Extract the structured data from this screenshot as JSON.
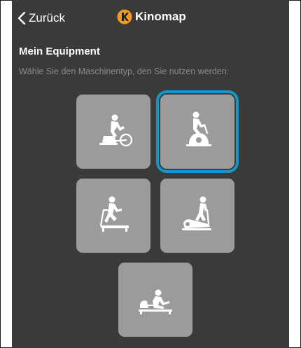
{
  "nav": {
    "back_label": "Zurück",
    "brand_name": "Kinomap"
  },
  "equipment": {
    "title": "Mein Equipment",
    "subtitle": "Wähle Sie den Maschinentyp, den Sie nutzen werden:",
    "machines": [
      {
        "icon": "bike-icon",
        "selected": false
      },
      {
        "icon": "exercise-bike-icon",
        "selected": true
      },
      {
        "icon": "treadmill-icon",
        "selected": false
      },
      {
        "icon": "elliptical-icon",
        "selected": false
      },
      {
        "icon": "rower-icon",
        "selected": false
      }
    ]
  },
  "colors": {
    "background": "#3a3a3a",
    "tile": "#9b9b9b",
    "selected_border": "#1497c7",
    "subtitle": "#8a8a8a"
  }
}
